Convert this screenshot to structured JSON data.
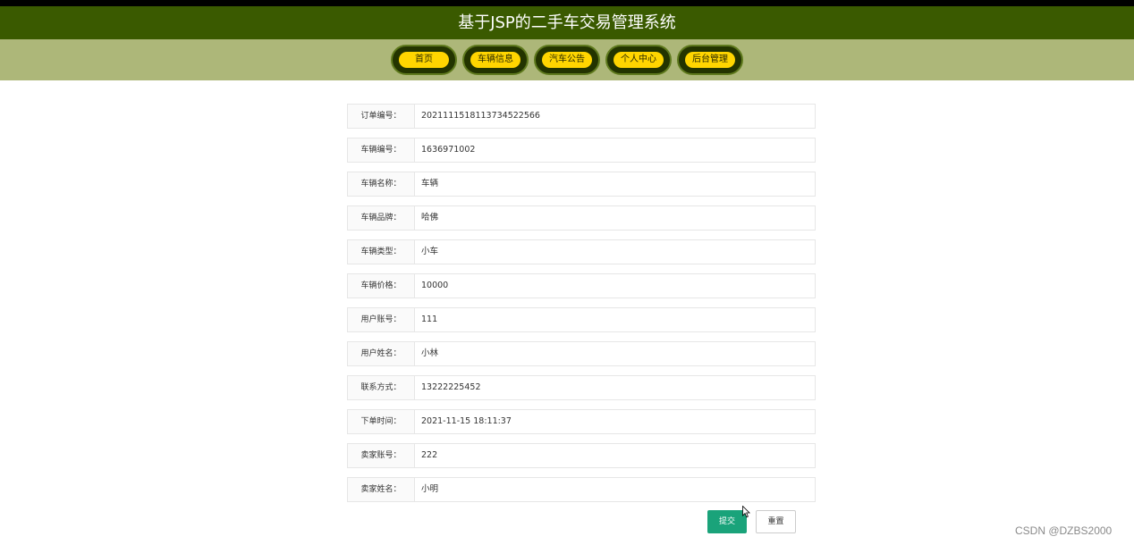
{
  "header": {
    "title": "基于JSP的二手车交易管理系统"
  },
  "nav": {
    "items": [
      {
        "label": "首页"
      },
      {
        "label": "车辆信息"
      },
      {
        "label": "汽车公告"
      },
      {
        "label": "个人中心"
      },
      {
        "label": "后台管理"
      }
    ]
  },
  "form": {
    "fields": [
      {
        "label": "订单编号：",
        "value": "20211115181137345225​66"
      },
      {
        "label": "车辆编号：",
        "value": "1636971002"
      },
      {
        "label": "车辆名称：",
        "value": "车辆"
      },
      {
        "label": "车辆品牌：",
        "value": "哈佛"
      },
      {
        "label": "车辆类型：",
        "value": "小车"
      },
      {
        "label": "车辆价格：",
        "value": "10000"
      },
      {
        "label": "用户账号：",
        "value": "111"
      },
      {
        "label": "用户姓名：",
        "value": "小林"
      },
      {
        "label": "联系方式：",
        "value": "13222225452"
      },
      {
        "label": "下单时间：",
        "value": "2021-11-15 18:11:37"
      },
      {
        "label": "卖家账号：",
        "value": "222"
      },
      {
        "label": "卖家姓名：",
        "value": "小明"
      }
    ],
    "submit_label": "提交",
    "reset_label": "重置"
  },
  "watermark": "CSDN @DZBS2000",
  "colors": {
    "title_bg": "#3a5a00",
    "nav_bg": "#adb779",
    "nav_pill": "#ffd500",
    "submit": "#1aa37a"
  }
}
